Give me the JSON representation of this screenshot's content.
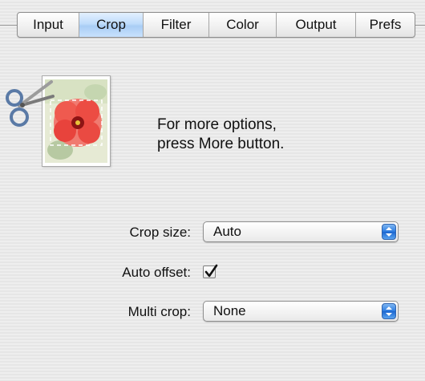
{
  "tabs": {
    "items": [
      {
        "label": "Input",
        "selected": false
      },
      {
        "label": "Crop",
        "selected": true
      },
      {
        "label": "Filter",
        "selected": false
      },
      {
        "label": "Color",
        "selected": false
      },
      {
        "label": "Output",
        "selected": false
      },
      {
        "label": "Prefs",
        "selected": false
      }
    ]
  },
  "preview": {
    "icon": "scissors-icon",
    "image": "flower-thumbnail",
    "message_line1": "For more options,",
    "message_line2": "press More button."
  },
  "form": {
    "crop_size": {
      "label": "Crop size:",
      "value": "Auto"
    },
    "auto_offset": {
      "label": "Auto offset:",
      "checked": true
    },
    "multi_crop": {
      "label": "Multi crop:",
      "value": "None"
    }
  },
  "colors": {
    "selected_tab": "#bfdcfb",
    "popup_arrow": "#2a7ae0",
    "flower": "#e8433c"
  }
}
